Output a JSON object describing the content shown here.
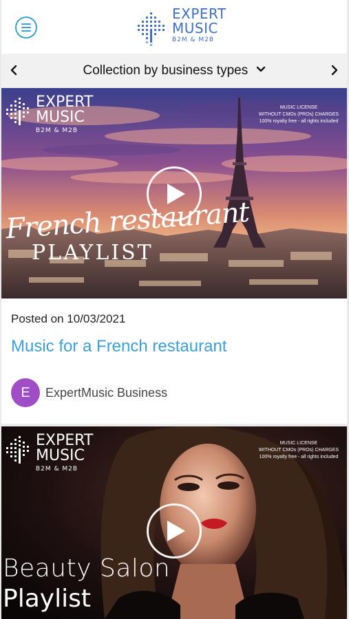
{
  "header": {
    "logo": {
      "line1": "EXPERT",
      "line2": "MUSIC",
      "line3": "B2M & M2B"
    }
  },
  "category_bar": {
    "title": "Collection by business types"
  },
  "posts": [
    {
      "brand": {
        "line1": "EXPERT",
        "line2": "MUSIC",
        "line3": "B2M & M2B"
      },
      "license": [
        "MUSIC LICENSE",
        "WITHOUT CMOs (PROs) CHARGES",
        "100% royalty free - all rights included"
      ],
      "overlay_title": "French restaurant",
      "overlay_sub": "PLAYLIST",
      "posted": "Posted on 10/03/2021",
      "title": "Music for a French restaurant",
      "author_initial": "E",
      "author": "ExpertMusic Business"
    },
    {
      "brand": {
        "line1": "EXPERT",
        "line2": "MUSIC",
        "line3": "B2M & M2B"
      },
      "license": [
        "MUSIC LICENSE",
        "WITHOUT CMOs (PROs) CHARGES",
        "100% royalty free - all rights included"
      ],
      "overlay_title": "Beauty Salon",
      "overlay_sub": "Playlist"
    }
  ],
  "colors": {
    "accent": "#3aa0d8",
    "logo": "#3d6fc7",
    "avatar": "#a04ec5"
  }
}
